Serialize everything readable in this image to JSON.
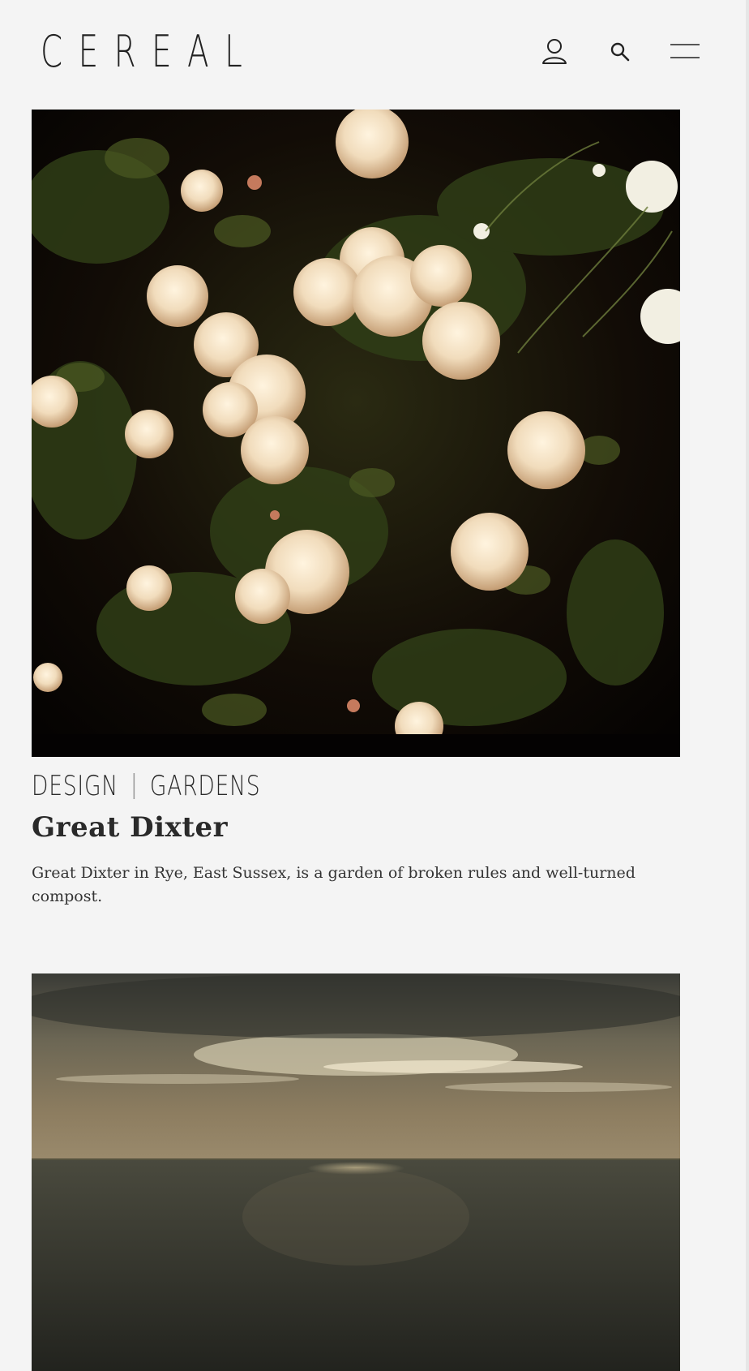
{
  "header": {
    "logo": "CEREAL",
    "icons": [
      "user-icon",
      "search-icon",
      "menu-icon"
    ]
  },
  "articles": [
    {
      "categories": [
        "DESIGN",
        "GARDENS"
      ],
      "title": "Great Dixter",
      "excerpt": "Great Dixter in Rye, East Sussex, is a garden of broken rules and well-turned compost."
    }
  ],
  "colors": {
    "background": "#f4f4f4",
    "text": "#222222"
  }
}
